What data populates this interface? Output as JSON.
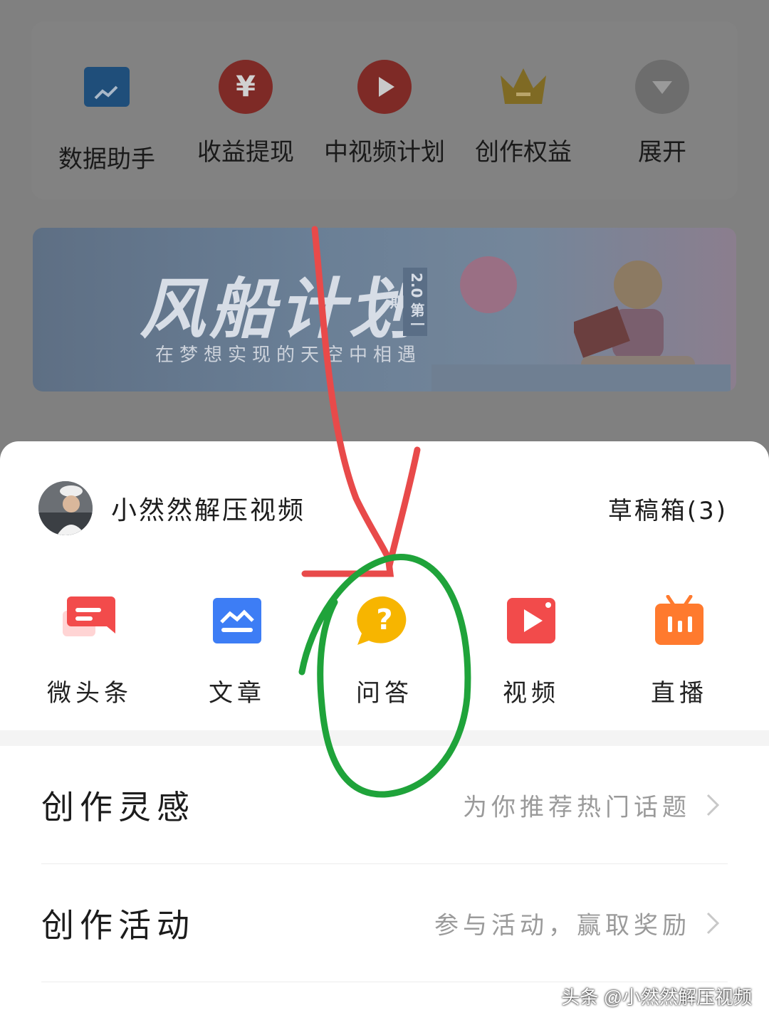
{
  "dashboard": {
    "shortcuts": [
      {
        "label": "数据助手",
        "icon": "chart-icon"
      },
      {
        "label": "收益提现",
        "icon": "yuan-icon"
      },
      {
        "label": "中视频计划",
        "icon": "video-plan-icon"
      },
      {
        "label": "创作权益",
        "icon": "crown-icon"
      },
      {
        "label": "展开",
        "icon": "chevron-down-icon"
      }
    ],
    "banner": {
      "title": "风船计划",
      "subtitle": "在梦想实现的天空中相遇",
      "version": "2.0",
      "issue": "第一期"
    }
  },
  "sheet": {
    "user": {
      "name": "小然然解压视频"
    },
    "drafts_label": "草稿箱(3)",
    "publish_options": [
      {
        "label": "微头条",
        "icon": "micro-post-icon",
        "color": "#F24B4B"
      },
      {
        "label": "文章",
        "icon": "article-icon",
        "color": "#3D7DF5"
      },
      {
        "label": "问答",
        "icon": "question-icon",
        "color": "#F7B500"
      },
      {
        "label": "视频",
        "icon": "video-play-icon",
        "color": "#F24B4B"
      },
      {
        "label": "直播",
        "icon": "live-tv-icon",
        "color": "#FF7A2E"
      }
    ],
    "rows": [
      {
        "title": "创作灵感",
        "hint": "为你推荐热门话题"
      },
      {
        "title": "创作活动",
        "hint": "参与活动，赢取奖励"
      }
    ]
  },
  "annotation_colors": {
    "arrow": "#E84A4A",
    "circle": "#1FA33A"
  },
  "watermark": "头条 @小然然解压视频"
}
